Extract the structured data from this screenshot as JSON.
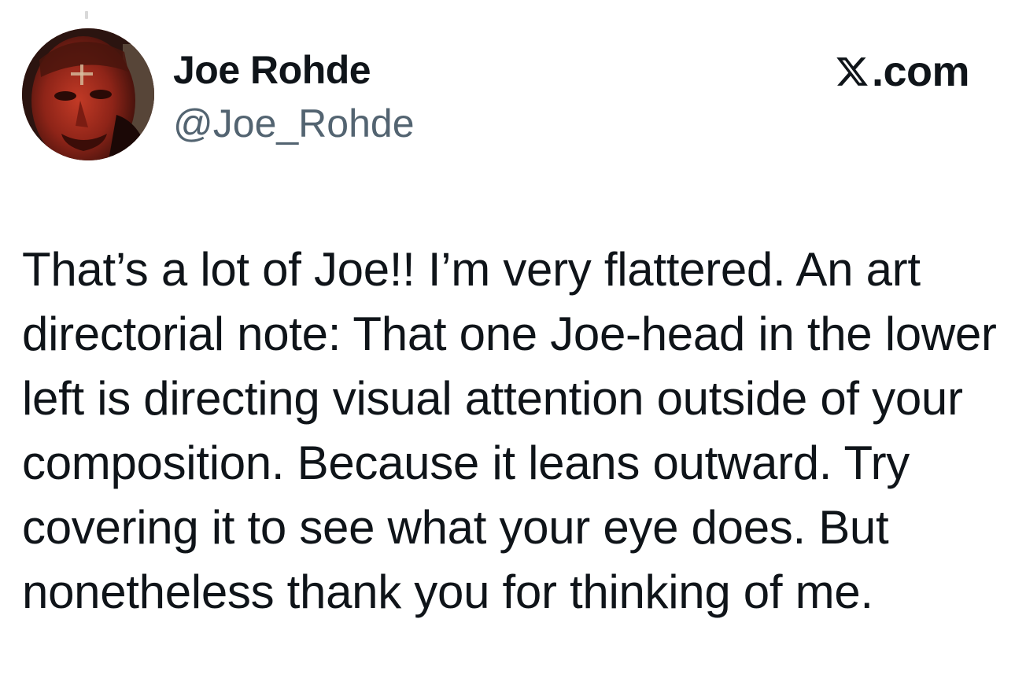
{
  "author": {
    "name": "Joe Rohde",
    "handle": "@Joe_Rohde"
  },
  "brand": {
    "label": ".com",
    "logo_icon": "x-logo-icon"
  },
  "tweet": {
    "text": "That’s a lot of Joe!! I’m very flattered. An art directorial note: That one Joe-head in the lower left is directing visual attention outside of your composition. Because it leans outward. Try covering it to see what your eye does. But nonetheless thank you for thinking of me."
  },
  "colors": {
    "text_primary": "#0f1419",
    "text_secondary": "#536471",
    "background": "#ffffff"
  }
}
